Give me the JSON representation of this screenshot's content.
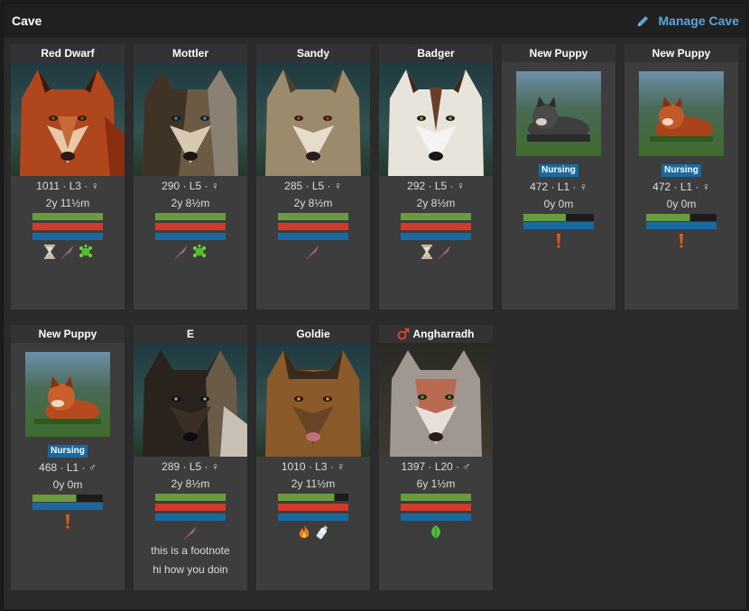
{
  "header": {
    "title": "Cave",
    "manage_label": "Manage Cave"
  },
  "row1": [
    {
      "name": "Red Dwarf",
      "stats": "1011 · L3 · ♀",
      "age": "2y 11½m",
      "status_icons": [
        "hourglass-icon",
        "feather-icon",
        "moss-icon"
      ]
    },
    {
      "name": "Mottler",
      "stats": "290 · L5 · ♀",
      "age": "2y 8½m",
      "status_icons": [
        "feather-icon",
        "moss-icon"
      ]
    },
    {
      "name": "Sandy",
      "stats": "285 · L5 · ♀",
      "age": "2y 8½m",
      "status_icons": [
        "feather-icon"
      ]
    },
    {
      "name": "Badger",
      "stats": "292 · L5 · ♀",
      "age": "2y 8½m",
      "status_icons": [
        "hourglass-icon",
        "feather-icon"
      ]
    },
    {
      "name": "New Puppy",
      "badge": "Nursing",
      "stats": "472 · L1 · ♀",
      "age": "0y 0m",
      "status_icons": [
        "exclamation-icon"
      ]
    },
    {
      "name": "New Puppy",
      "badge": "Nursing",
      "stats": "472 · L1 · ♀",
      "age": "0y 0m",
      "status_icons": [
        "exclamation-icon"
      ]
    }
  ],
  "row2": [
    {
      "name": "New Puppy",
      "badge": "Nursing",
      "stats": "468 · L1 · ♂",
      "age": "0y 0m",
      "status_icons": [
        "exclamation-icon"
      ]
    },
    {
      "name": "E",
      "stats": "289 · L5 · ♀",
      "age": "2y 8½m",
      "status_icons": [
        "feather-icon"
      ],
      "note_lines": [
        "this is a footnote",
        "hi how you doin"
      ]
    },
    {
      "name": "Goldie",
      "stats": "1010 · L3 · ♀",
      "age": "2y 11½m",
      "status_icons": [
        "fire-icon",
        "bottle-icon"
      ]
    },
    {
      "name": "Angharradh",
      "name_icon": "male-symbol-icon",
      "stats": "1397 · L20 · ♂",
      "age": "6y 1½m",
      "status_icons": [
        "leaf-icon"
      ]
    }
  ],
  "colors": {
    "bar_green": "#6a9c3f",
    "bar_red": "#d43a2a",
    "bar_blue": "#1a6aa1",
    "bar_empty": "#1c1c1c",
    "link": "#5aa4d8"
  },
  "meters": {
    "red_dwarf": {
      "green": 1.0,
      "red": 1.0,
      "blue": 1.0
    },
    "mottler": {
      "green": 1.0,
      "red": 1.0,
      "blue": 1.0
    },
    "sandy": {
      "green": 1.0,
      "red": 1.0,
      "blue": 1.0
    },
    "badger": {
      "green": 1.0,
      "red": 1.0,
      "blue": 1.0
    },
    "puppy1": {
      "green": 0.6,
      "blue": 1.0
    },
    "puppy2": {
      "green": 0.62,
      "blue": 1.0
    },
    "puppy3": {
      "green": 0.62,
      "blue": 1.0
    },
    "e": {
      "green": 1.0,
      "red": 1.0,
      "blue": 1.0
    },
    "goldie": {
      "green": 0.8,
      "red": 1.0,
      "blue": 1.0
    },
    "angharradh": {
      "green": 1.0,
      "red": 1.0,
      "blue": 1.0
    }
  }
}
